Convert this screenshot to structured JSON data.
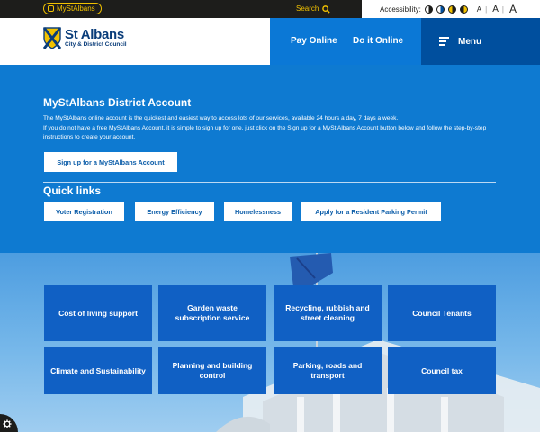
{
  "topbar": {
    "account_pill": "MyStAlbans",
    "search_label": "Search",
    "accessibility_label": "Accessibility:",
    "text_sizes": [
      "A",
      "A",
      "A"
    ]
  },
  "header": {
    "logo_name": "St Albans",
    "logo_sub": "City & District Council",
    "nav": [
      "Pay Online",
      "Do it Online"
    ],
    "menu_label": "Menu"
  },
  "account": {
    "title": "MyStAlbans District Account",
    "paragraph_1": "The MyStAlbans online account is the quickest and easiest way to access lots of our services, available 24 hours a day, 7 days a week.",
    "paragraph_2": "If you do not have a free MyStAlbans Account, it is simple to sign up for one, just click on the Sign up for a MySt Albans Account button below and follow the step-by-step instructions to create your account.",
    "signup_button": "Sign up for a MyStAlbans Account"
  },
  "quick_links": {
    "title": "Quick links",
    "items": [
      "Voter Registration",
      "Energy Efficiency",
      "Homelessness",
      "Apply for a Resident Parking Permit"
    ]
  },
  "tiles": [
    "Cost of living support",
    "Garden waste subscription service",
    "Recycling, rubbish and street cleaning",
    "Council Tenants",
    "Climate and Sustainability",
    "Planning and building control",
    "Parking, roads and transport",
    "Council tax"
  ],
  "colors": {
    "brand_blue": "#0e7ad1",
    "navy": "#004f9e",
    "tile_blue": "#1060c4",
    "accent_yellow": "#f2c200",
    "topbar_black": "#1d1d1b"
  }
}
